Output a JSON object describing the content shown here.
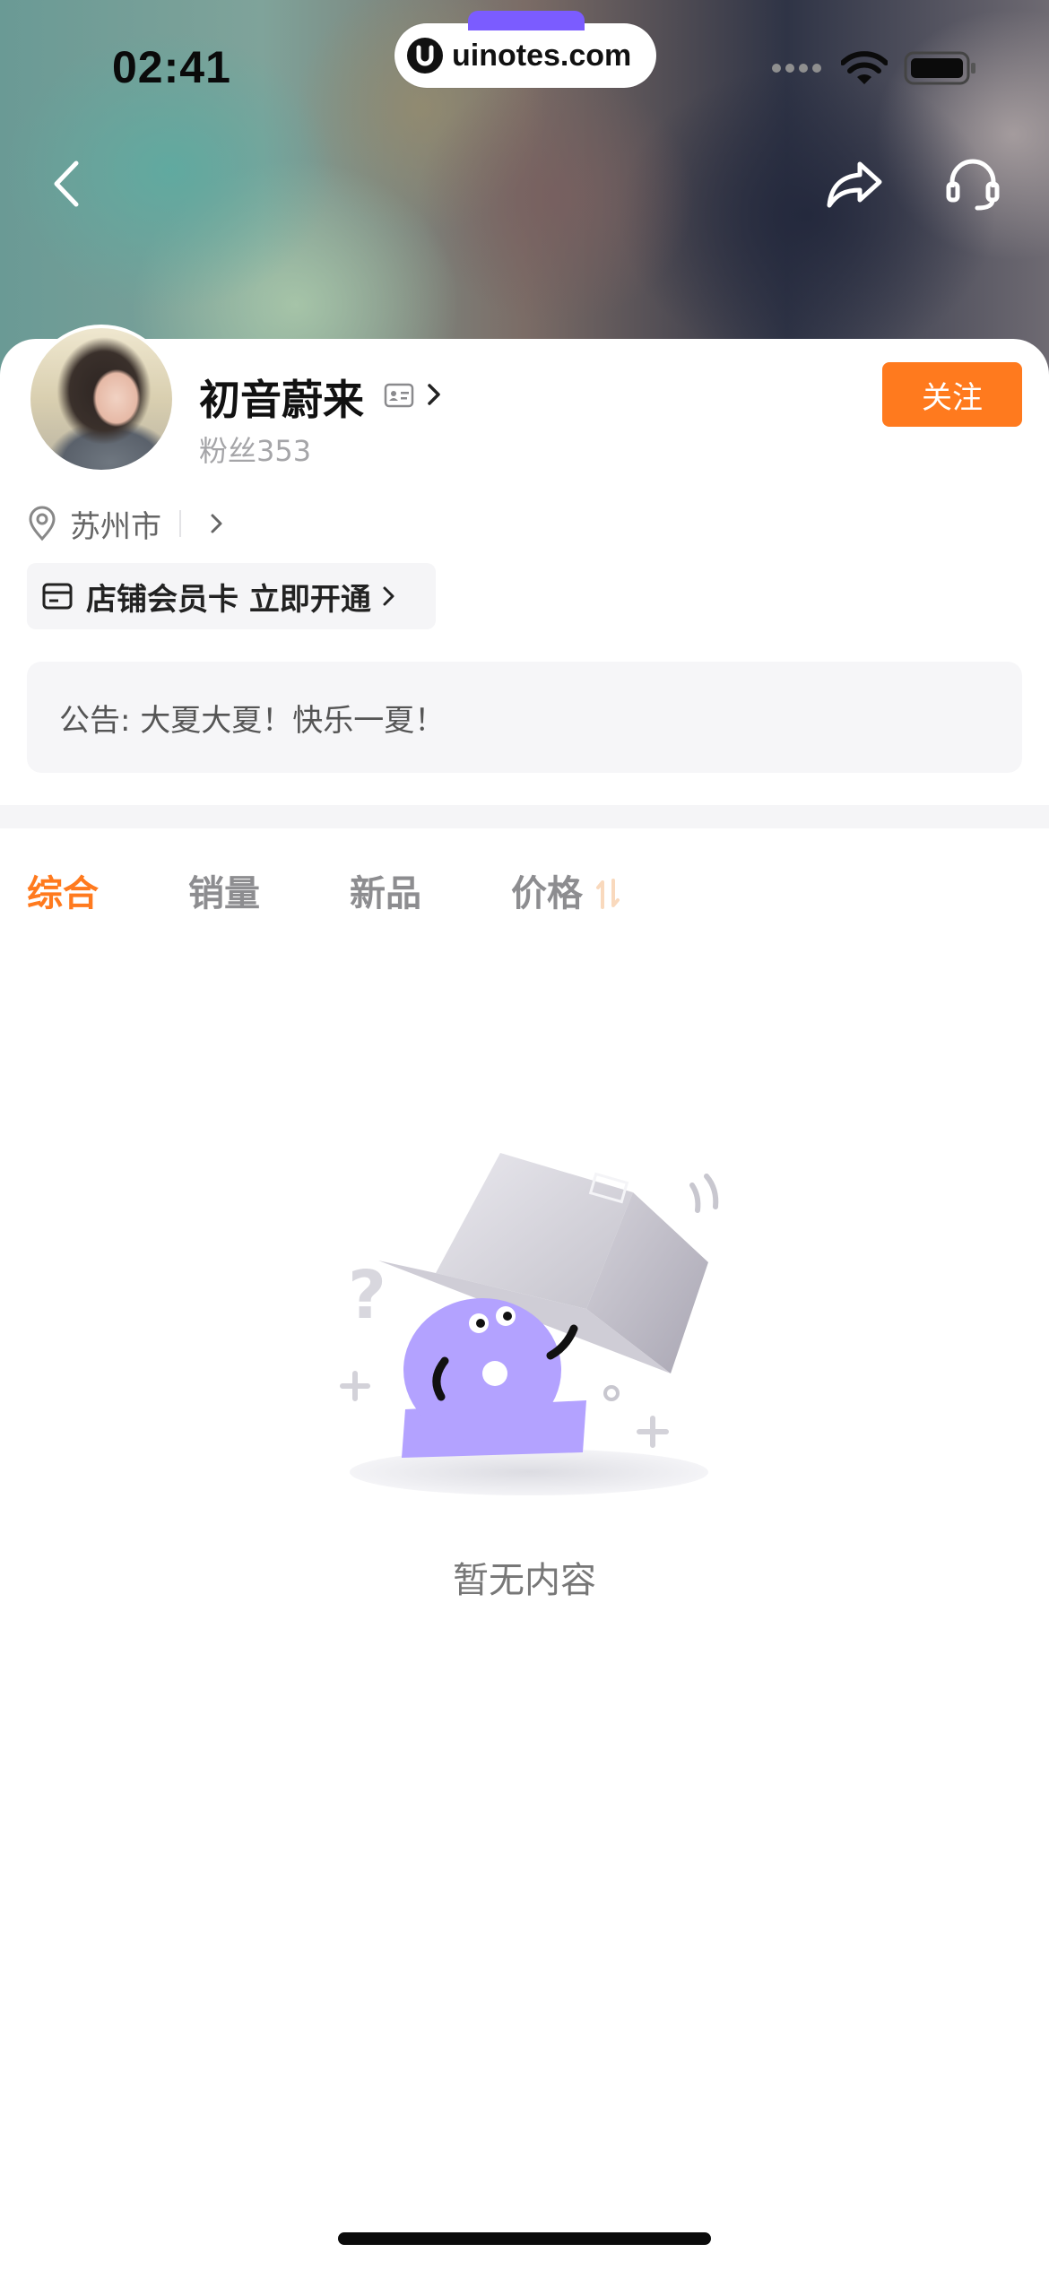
{
  "status_bar": {
    "time": "02:41",
    "url": "uinotes.com"
  },
  "header": {
    "back_icon": "chevron-left-icon",
    "share_icon": "share-arrow-icon",
    "service_icon": "headset-icon"
  },
  "profile": {
    "name": "初音蔚来",
    "fans_label": "粉丝353",
    "follow_label": "关注",
    "location": "苏州市",
    "member_card_label": "店铺会员卡 立即开通",
    "notice": "公告: 大夏大夏！快乐一夏！"
  },
  "tabs": [
    {
      "label": "综合",
      "active": true
    },
    {
      "label": "销量",
      "active": false
    },
    {
      "label": "新品",
      "active": false
    },
    {
      "label": "价格",
      "active": false
    }
  ],
  "empty_state": {
    "message": "暂无内容"
  },
  "colors": {
    "accent": "#ff7a1e",
    "purple": "#b3a2ff"
  }
}
